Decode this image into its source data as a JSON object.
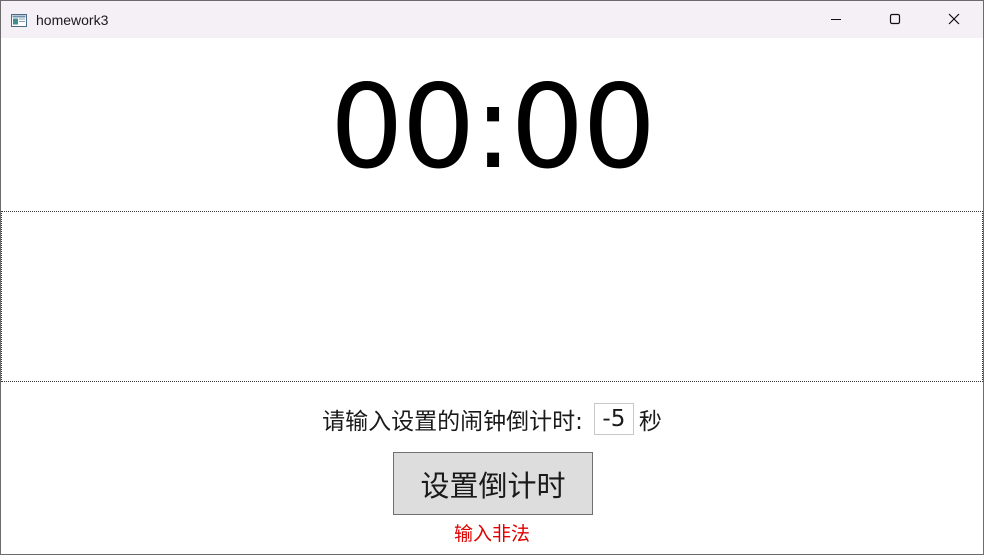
{
  "window": {
    "title": "homework3",
    "controls": {
      "minimize": "minimize-icon",
      "maximize": "maximize-icon",
      "close": "close-icon"
    }
  },
  "timer": {
    "display": "00:00"
  },
  "form": {
    "prompt_label": "请输入设置的闹钟倒计时:",
    "seconds_value": "-5",
    "unit_label": "秒",
    "set_button_label": "设置倒计时",
    "error_message": "输入非法"
  },
  "colors": {
    "titlebar_bg": "#f5eff6",
    "button_bg": "#dddddd",
    "error": "#e00000"
  }
}
